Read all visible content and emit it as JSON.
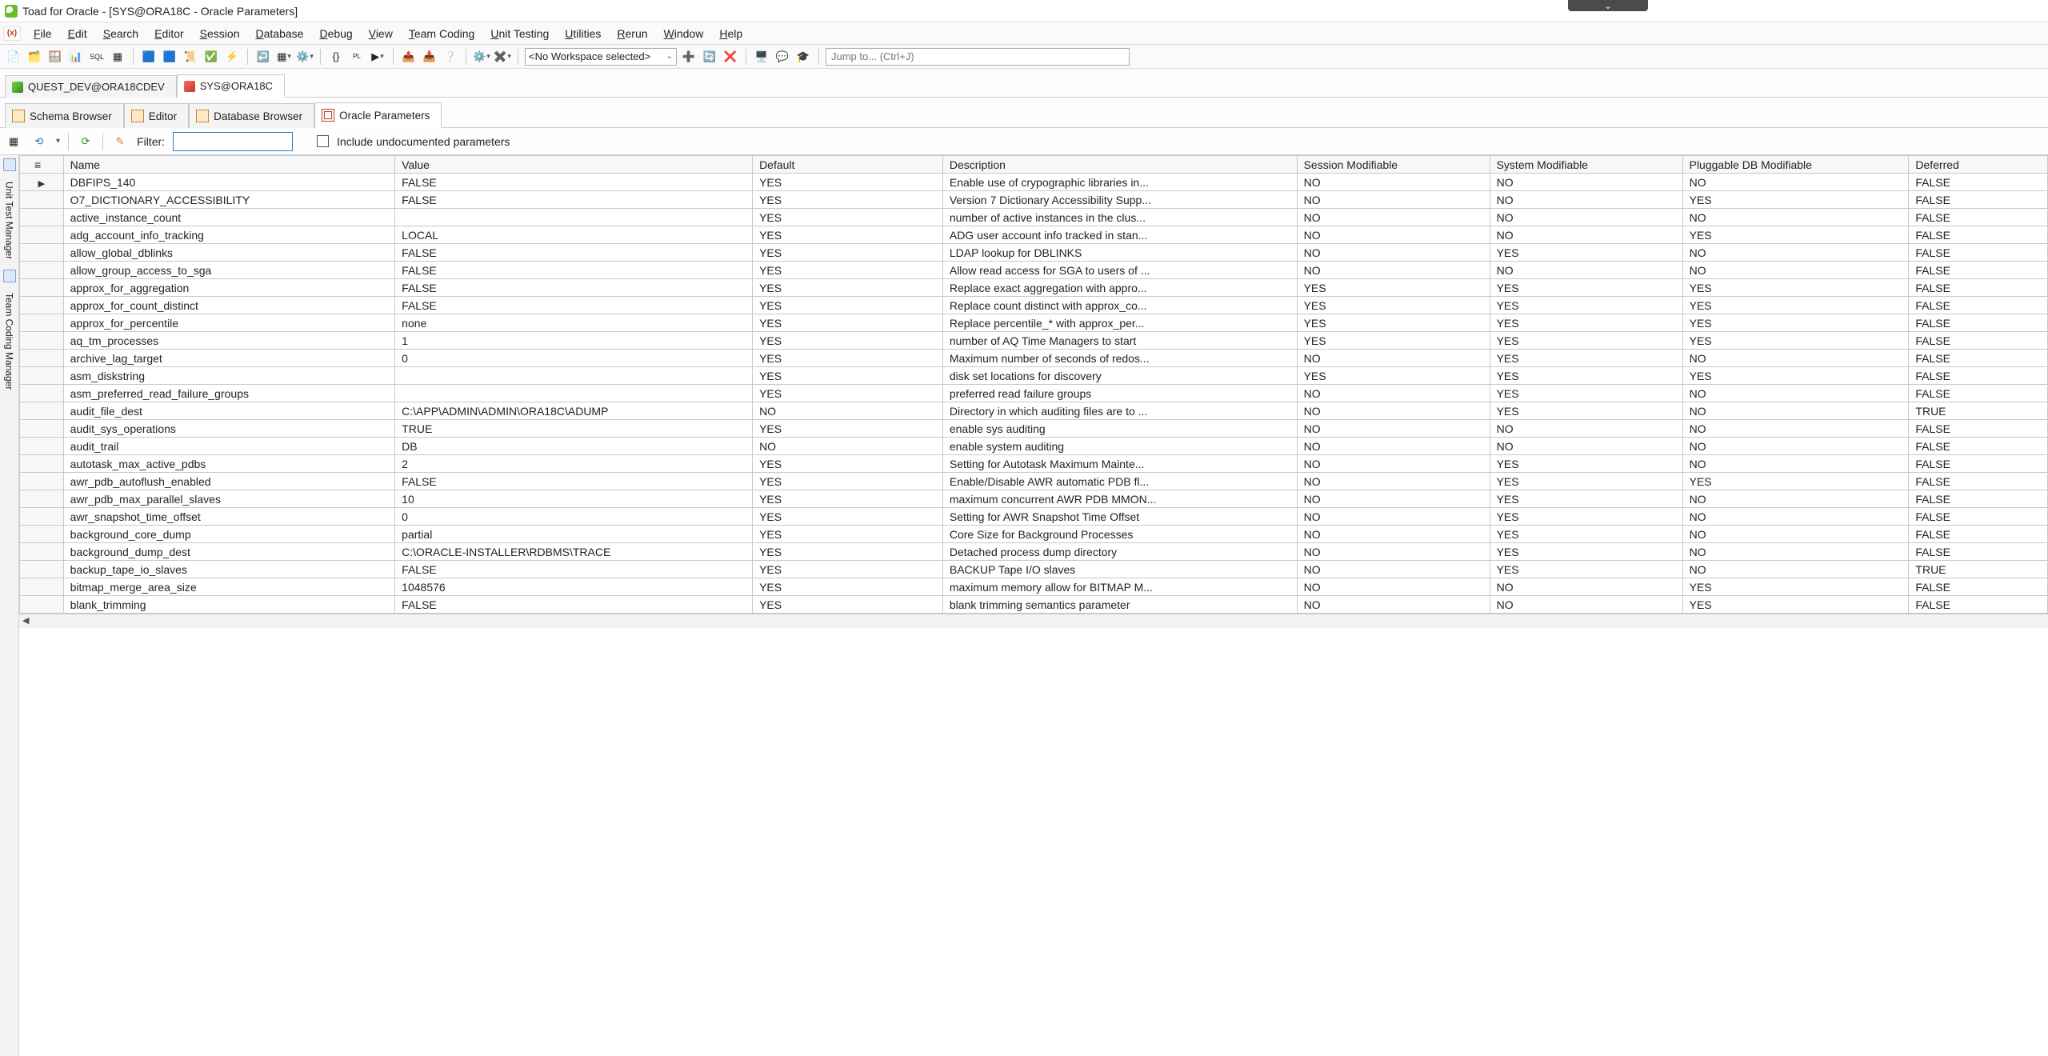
{
  "window": {
    "title": "Toad for Oracle - [SYS@ORA18C - Oracle Parameters]"
  },
  "menu": {
    "items": [
      {
        "label": "File",
        "accel": "F"
      },
      {
        "label": "Edit",
        "accel": "E"
      },
      {
        "label": "Search",
        "accel": "S"
      },
      {
        "label": "Editor",
        "accel": "E"
      },
      {
        "label": "Session",
        "accel": "S"
      },
      {
        "label": "Database",
        "accel": "D"
      },
      {
        "label": "Debug",
        "accel": "D"
      },
      {
        "label": "View",
        "accel": "V"
      },
      {
        "label": "Team Coding",
        "accel": "T"
      },
      {
        "label": "Unit Testing",
        "accel": "U"
      },
      {
        "label": "Utilities",
        "accel": "U"
      },
      {
        "label": "Rerun",
        "accel": "R"
      },
      {
        "label": "Window",
        "accel": "W"
      },
      {
        "label": "Help",
        "accel": "H"
      }
    ]
  },
  "toolbar": {
    "workspace_selected": "<No Workspace selected>",
    "jump_placeholder": "Jump to... (Ctrl+J)"
  },
  "connection_tabs": [
    {
      "label": "QUEST_DEV@ORA18CDEV",
      "active": false,
      "color": "green"
    },
    {
      "label": "SYS@ORA18C",
      "active": true,
      "color": "red"
    }
  ],
  "document_tabs": [
    {
      "label": "Schema Browser",
      "active": false
    },
    {
      "label": "Editor",
      "active": false
    },
    {
      "label": "Database Browser",
      "active": false
    },
    {
      "label": "Oracle Parameters",
      "active": true
    }
  ],
  "filter": {
    "label": "Filter:",
    "value": "",
    "undoc_label": "Include undocumented parameters",
    "undoc_checked": false
  },
  "side_rail": {
    "items": [
      "Unit Test Manager",
      "Team Coding Manager"
    ]
  },
  "grid": {
    "columns": [
      "Name",
      "Value",
      "Default",
      "Description",
      "Session Modifiable",
      "System Modifiable",
      "Pluggable DB Modifiable",
      "Deferred"
    ],
    "rows": [
      {
        "name": "DBFIPS_140",
        "value": "FALSE",
        "default": "YES",
        "desc": "Enable use of crypographic libraries in...",
        "sess": "NO",
        "sys": "NO",
        "pdb": "NO",
        "defr": "FALSE",
        "current": true
      },
      {
        "name": "O7_DICTIONARY_ACCESSIBILITY",
        "value": "FALSE",
        "default": "YES",
        "desc": "Version 7 Dictionary Accessibility Supp...",
        "sess": "NO",
        "sys": "NO",
        "pdb": "YES",
        "defr": "FALSE"
      },
      {
        "name": "active_instance_count",
        "value": "",
        "default": "YES",
        "desc": "number of active instances in the clus...",
        "sess": "NO",
        "sys": "NO",
        "pdb": "NO",
        "defr": "FALSE"
      },
      {
        "name": "adg_account_info_tracking",
        "value": "LOCAL",
        "default": "YES",
        "desc": "ADG user account info tracked in stan...",
        "sess": "NO",
        "sys": "NO",
        "pdb": "YES",
        "defr": "FALSE"
      },
      {
        "name": "allow_global_dblinks",
        "value": "FALSE",
        "default": "YES",
        "desc": "LDAP lookup for DBLINKS",
        "sess": "NO",
        "sys": "YES",
        "pdb": "NO",
        "defr": "FALSE"
      },
      {
        "name": "allow_group_access_to_sga",
        "value": "FALSE",
        "default": "YES",
        "desc": "Allow read access for SGA to users of ...",
        "sess": "NO",
        "sys": "NO",
        "pdb": "NO",
        "defr": "FALSE"
      },
      {
        "name": "approx_for_aggregation",
        "value": "FALSE",
        "default": "YES",
        "desc": "Replace exact aggregation with appro...",
        "sess": "YES",
        "sys": "YES",
        "pdb": "YES",
        "defr": "FALSE"
      },
      {
        "name": "approx_for_count_distinct",
        "value": "FALSE",
        "default": "YES",
        "desc": "Replace count distinct with approx_co...",
        "sess": "YES",
        "sys": "YES",
        "pdb": "YES",
        "defr": "FALSE"
      },
      {
        "name": "approx_for_percentile",
        "value": "none",
        "default": "YES",
        "desc": "Replace percentile_* with approx_per...",
        "sess": "YES",
        "sys": "YES",
        "pdb": "YES",
        "defr": "FALSE"
      },
      {
        "name": "aq_tm_processes",
        "value": "1",
        "default": "YES",
        "desc": "number of AQ Time Managers to start",
        "sess": "YES",
        "sys": "YES",
        "pdb": "YES",
        "defr": "FALSE"
      },
      {
        "name": "archive_lag_target",
        "value": "0",
        "default": "YES",
        "desc": "Maximum number of seconds of redos...",
        "sess": "NO",
        "sys": "YES",
        "pdb": "NO",
        "defr": "FALSE"
      },
      {
        "name": "asm_diskstring",
        "value": "",
        "default": "YES",
        "desc": "disk set locations for discovery",
        "sess": "YES",
        "sys": "YES",
        "pdb": "YES",
        "defr": "FALSE"
      },
      {
        "name": "asm_preferred_read_failure_groups",
        "value": "",
        "default": "YES",
        "desc": "preferred read failure groups",
        "sess": "NO",
        "sys": "YES",
        "pdb": "NO",
        "defr": "FALSE"
      },
      {
        "name": "audit_file_dest",
        "value": "C:\\APP\\ADMIN\\ADMIN\\ORA18C\\ADUMP",
        "default": "NO",
        "desc": "Directory in which auditing files are to ...",
        "sess": "NO",
        "sys": "YES",
        "pdb": "NO",
        "defr": "TRUE"
      },
      {
        "name": "audit_sys_operations",
        "value": "TRUE",
        "default": "YES",
        "desc": "enable sys auditing",
        "sess": "NO",
        "sys": "NO",
        "pdb": "NO",
        "defr": "FALSE"
      },
      {
        "name": "audit_trail",
        "value": "DB",
        "default": "NO",
        "desc": "enable system auditing",
        "sess": "NO",
        "sys": "NO",
        "pdb": "NO",
        "defr": "FALSE"
      },
      {
        "name": "autotask_max_active_pdbs",
        "value": "2",
        "default": "YES",
        "desc": "Setting for Autotask Maximum Mainte...",
        "sess": "NO",
        "sys": "YES",
        "pdb": "NO",
        "defr": "FALSE"
      },
      {
        "name": "awr_pdb_autoflush_enabled",
        "value": "FALSE",
        "default": "YES",
        "desc": "Enable/Disable AWR automatic PDB fl...",
        "sess": "NO",
        "sys": "YES",
        "pdb": "YES",
        "defr": "FALSE"
      },
      {
        "name": "awr_pdb_max_parallel_slaves",
        "value": "10",
        "default": "YES",
        "desc": "maximum concurrent AWR PDB MMON...",
        "sess": "NO",
        "sys": "YES",
        "pdb": "NO",
        "defr": "FALSE"
      },
      {
        "name": "awr_snapshot_time_offset",
        "value": "0",
        "default": "YES",
        "desc": "Setting for AWR Snapshot Time Offset",
        "sess": "NO",
        "sys": "YES",
        "pdb": "NO",
        "defr": "FALSE"
      },
      {
        "name": "background_core_dump",
        "value": "partial",
        "default": "YES",
        "desc": "Core Size for Background Processes",
        "sess": "NO",
        "sys": "YES",
        "pdb": "NO",
        "defr": "FALSE"
      },
      {
        "name": "background_dump_dest",
        "value": "C:\\ORACLE-INSTALLER\\RDBMS\\TRACE",
        "default": "YES",
        "desc": "Detached process dump directory",
        "sess": "NO",
        "sys": "YES",
        "pdb": "NO",
        "defr": "FALSE"
      },
      {
        "name": "backup_tape_io_slaves",
        "value": "FALSE",
        "default": "YES",
        "desc": "BACKUP Tape I/O slaves",
        "sess": "NO",
        "sys": "YES",
        "pdb": "NO",
        "defr": "TRUE"
      },
      {
        "name": "bitmap_merge_area_size",
        "value": "1048576",
        "default": "YES",
        "desc": "maximum memory allow for BITMAP M...",
        "sess": "NO",
        "sys": "NO",
        "pdb": "YES",
        "defr": "FALSE"
      },
      {
        "name": "blank_trimming",
        "value": "FALSE",
        "default": "YES",
        "desc": "blank trimming semantics parameter",
        "sess": "NO",
        "sys": "NO",
        "pdb": "YES",
        "defr": "FALSE"
      }
    ]
  }
}
